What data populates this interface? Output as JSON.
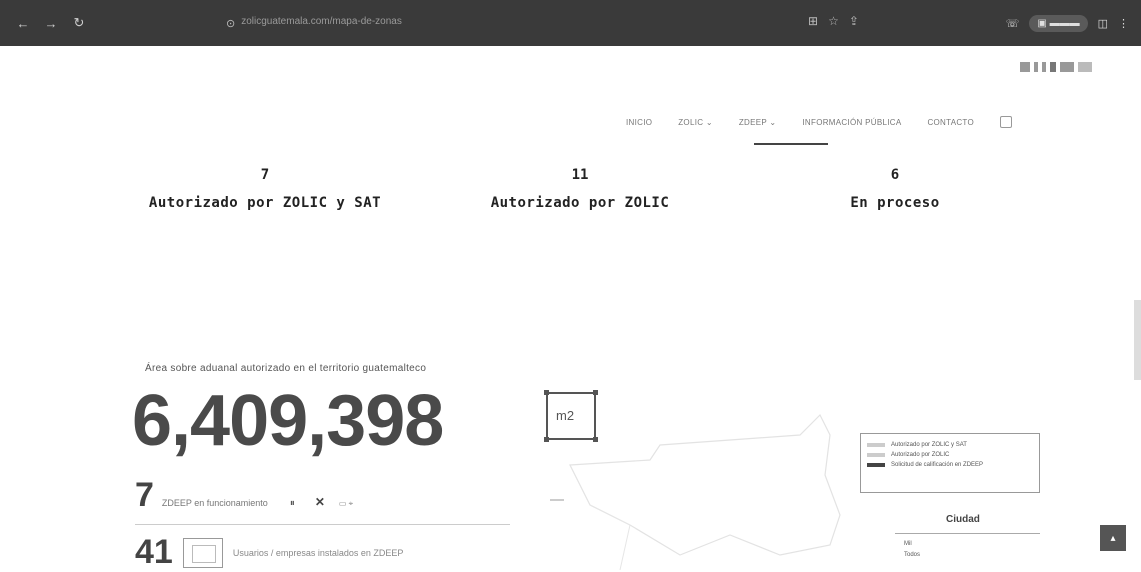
{
  "browser": {
    "back_icon": "back-arrow-icon",
    "url": "zolicguatemala.com/mapa-de-zonas"
  },
  "nav": {
    "items": [
      "INICIO",
      "ZOLIC",
      "ZDEEP",
      "INFORMACIÓN PÚBLICA",
      "CONTACTO"
    ]
  },
  "stats": [
    {
      "number": "7",
      "label": "Autorizado por ZOLIC y SAT"
    },
    {
      "number": "11",
      "label": "Autorizado por ZOLIC"
    },
    {
      "number": "6",
      "label": "En proceso"
    }
  ],
  "area": {
    "caption": "Área sobre aduanal autorizado en el territorio guatemalteco",
    "value": "6,409,398",
    "unit": "m2"
  },
  "rows": {
    "zdeep_count": "7",
    "zdeep_text": "ZDEEP en funcionamiento",
    "users_count": "41",
    "users_text": "Usuarios / empresas instalados en ZDEEP"
  },
  "legend": {
    "items": [
      "Autorizado por ZOLIC y SAT",
      "Autorizado por ZOLIC",
      "Solicitud de calificación en ZDEEP"
    ]
  },
  "city": {
    "title": "Ciudad",
    "items": [
      "Mil",
      "Todos"
    ]
  },
  "colors": {
    "accent": "#444444",
    "chrome": "#3a3a3a"
  }
}
